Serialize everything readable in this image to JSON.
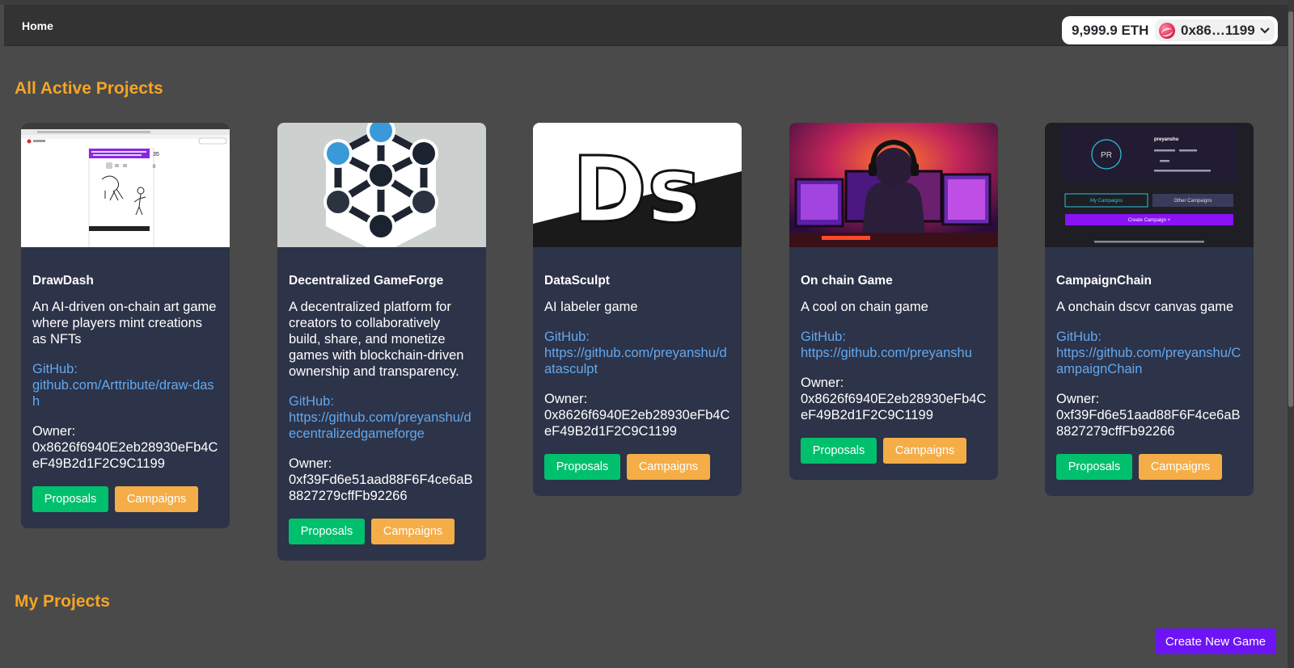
{
  "nav": {
    "home_label": "Home",
    "balance": "9,999.9 ETH",
    "account": "0x86…1199",
    "chevron": "❯"
  },
  "sections": {
    "active_title": "All Active Projects",
    "my_title": "My Projects"
  },
  "projects": [
    {
      "title": "DrawDash",
      "description": "An AI-driven on-chain art game where players mint creations as NFTs",
      "github_label": "GitHub:",
      "github_url": "github.com/Arttribute/draw-dash",
      "owner_label": "Owner:",
      "owner": "0x8626f6940E2eb28930eFb4CeF49B2d1F2C9C1199",
      "proposals_label": "Proposals",
      "campaigns_label": "Campaigns",
      "thumb_icon": "app-screenshot-thumbnail"
    },
    {
      "title": "Decentralized GameForge",
      "description": "A decentralized platform for creators to collaboratively build, share, and monetize games with blockchain-driven ownership and transparency.",
      "github_label": "GitHub:",
      "github_url": "https://github.com/preyanshu/decentralizedgameforge",
      "owner_label": "Owner:",
      "owner": "0xf39Fd6e51aad88F6F4ce6aB8827279cffFb92266",
      "proposals_label": "Proposals",
      "campaigns_label": "Campaigns",
      "thumb_icon": "network-nodes-logo"
    },
    {
      "title": "DataSculpt",
      "description": "AI labeler game",
      "github_label": "GitHub:",
      "github_url": "https://github.com/preyanshu/datasculpt",
      "owner_label": "Owner:",
      "owner": "0x8626f6940E2eb28930eFb4CeF49B2d1F2C9C1199",
      "proposals_label": "Proposals",
      "campaigns_label": "Campaigns",
      "thumb_icon": "ds-logo",
      "thumb_text": "Ds"
    },
    {
      "title": "On chain Game",
      "description": "A cool on chain game",
      "github_label": "GitHub:",
      "github_url": "https://github.com/preyanshu",
      "owner_label": "Owner:",
      "owner": "0x8626f6940E2eb28930eFb4CeF49B2d1F2C9C1199",
      "proposals_label": "Proposals",
      "campaigns_label": "Campaigns",
      "thumb_icon": "gamer-illustration"
    },
    {
      "title": "CampaignChain",
      "description": "A onchain dscvr canvas game",
      "github_label": "GitHub:",
      "github_url": "https://github.com/preyanshu/CampaignChain",
      "owner_label": "Owner:",
      "owner": "0xf39Fd6e51aad88F6F4ce6aB8827279cffFb92266",
      "proposals_label": "Proposals",
      "campaigns_label": "Campaigns",
      "thumb_icon": "app-screenshot-thumbnail",
      "thumb_ui": {
        "initials": "PR",
        "username": "preyanshu",
        "tab_mine": "My Campaigns",
        "tab_other": "Other Campaigns",
        "create": "Create Campaign +"
      }
    }
  ],
  "create_button": "Create New Game",
  "colors": {
    "accent": "#f5a524",
    "card_bg": "#2d3348",
    "link": "#63a8ee",
    "proposals": "#00c06e",
    "campaigns": "#f5ad47",
    "create": "#6d14f5"
  }
}
